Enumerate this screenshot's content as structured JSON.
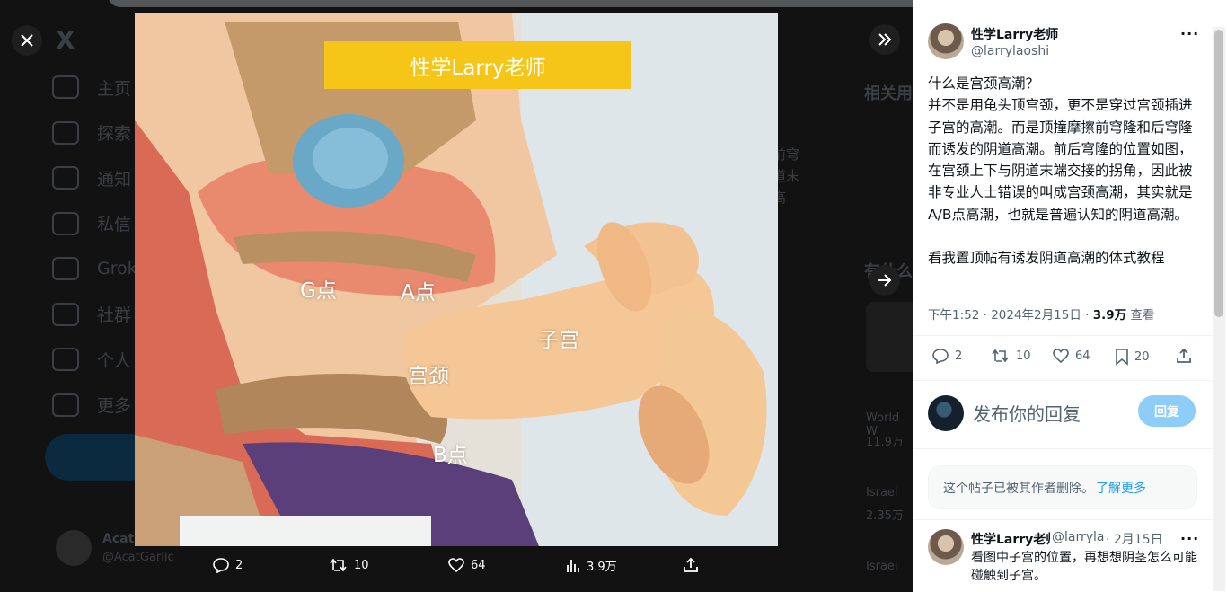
{
  "background_app": {
    "logo": "X",
    "nav_items": [
      "主页",
      "探索",
      "通知",
      "私信",
      "Grok",
      "社群",
      "个人",
      "更多"
    ],
    "profile_name": "Acat",
    "profile_handle": "@AcatGarlic",
    "right_heading_1": "相关用",
    "right_heading_2": "有什么",
    "trend_1": "World W",
    "trend_1_count": "11.9万",
    "trend_2": "Israel",
    "trend_2_count": "2.35万",
    "trend_3": "Israel",
    "mid_text": [
      "前穹",
      "道末",
      "高"
    ]
  },
  "media": {
    "banner": "性学Larry老师",
    "labels": {
      "g_spot": "G点",
      "a_spot": "A点",
      "uterus": "子宫",
      "cervix": "宫颈",
      "b_spot": "B点"
    },
    "actions": {
      "replies": "2",
      "reposts": "10",
      "likes": "64",
      "views": "3.9万"
    }
  },
  "post": {
    "author_name": "性学Larry老师",
    "author_handle": "@larrylaoshi",
    "text_lines": [
      "什么是宫颈高潮？",
      "并不是用龟头顶宫颈，更不是穿过宫颈插进子宫的高潮。而是顶撞摩擦前穹隆和后穹隆而诱发的阴道高潮。前后穹隆的位置如图，在宫颈上下与阴道末端交接的拐角，因此被非专业人士错误的叫成宫颈高潮，其实就是A/B点高潮，也就是普遍认知的阴道高潮。",
      "",
      "看我置顶帖有诱发阴道高潮的体式教程"
    ],
    "time": "下午1:52 · 2024年2月15日 · ",
    "views_count": "3.9万",
    "views_label": " 查看",
    "actions": {
      "replies": "2",
      "reposts": "10",
      "likes": "64",
      "bookmarks": "20"
    }
  },
  "reply_box": {
    "placeholder": "发布你的回复",
    "button": "回复"
  },
  "deleted_notice": {
    "text": "这个帖子已被其作者删除。",
    "link": "了解更多"
  },
  "reply": {
    "author_name": "性学Larry老师",
    "author_handle": "@larrylaoshi",
    "date": "· 2月15日",
    "text": "看图中子宫的位置，再想想阴茎怎么可能碰触到子宫。"
  },
  "colors": {
    "banner_yellow": "#f5c518",
    "link_blue": "#1d9bf0",
    "reply_button": "#8ecdf8",
    "secondary_text": "#536471"
  }
}
